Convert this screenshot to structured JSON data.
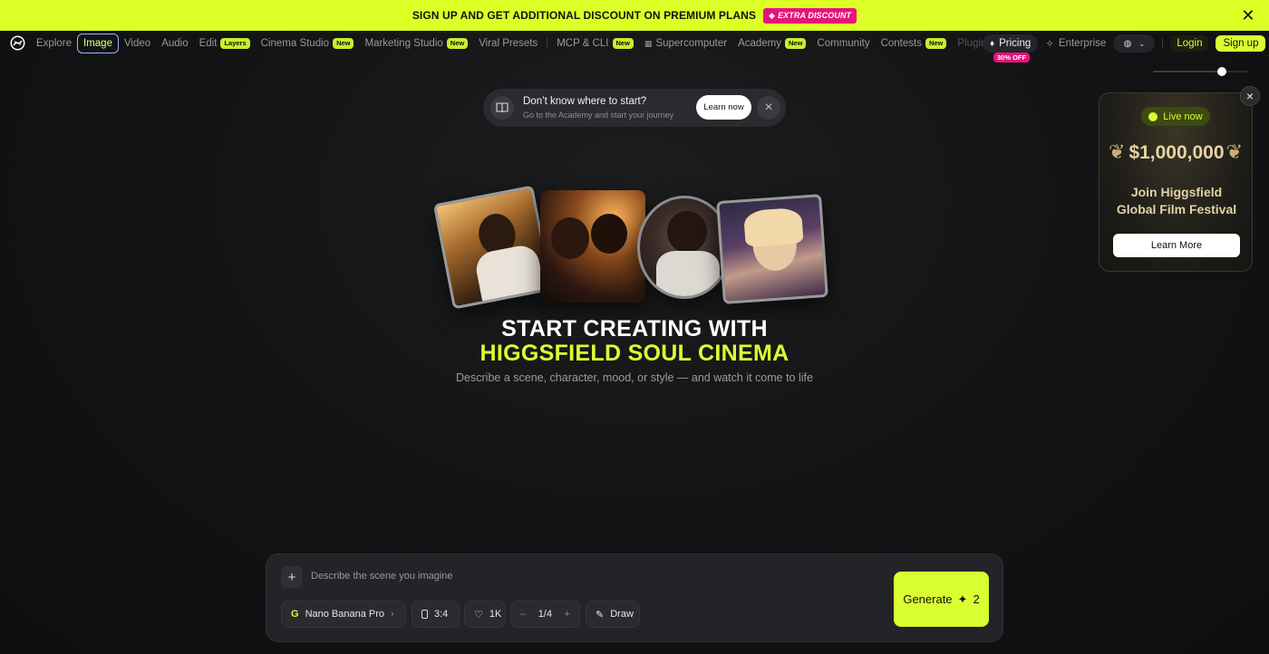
{
  "promo": {
    "text": "SIGN UP AND GET ADDITIONAL DISCOUNT ON PREMIUM PLANS",
    "badge": "EXTRA DISCOUNT",
    "close_icon": "close-icon"
  },
  "nav": {
    "logo_icon": "higgsfield-logo-icon",
    "items": [
      {
        "label": "Explore"
      },
      {
        "label": "Image",
        "active": true
      },
      {
        "label": "Video"
      },
      {
        "label": "Audio"
      },
      {
        "label": "Edit",
        "tag": "Layers"
      },
      {
        "label": "Cinema Studio",
        "tag": "New"
      },
      {
        "label": "Marketing Studio",
        "tag": "New"
      },
      {
        "label": "Viral Presets"
      },
      {
        "label": "MCP & CLI",
        "tag": "New"
      },
      {
        "label": "Supercomputer"
      },
      {
        "label": "Academy",
        "tag": "New"
      },
      {
        "label": "Community"
      },
      {
        "label": "Contests",
        "tag": "New"
      },
      {
        "label": "Plugins"
      }
    ],
    "pricing": {
      "label": "Pricing",
      "badge": "30% OFF"
    },
    "enterprise": "Enterprise",
    "login": "Login",
    "signup": "Sign up"
  },
  "zoom_slider": {
    "value": 0.72
  },
  "tip": {
    "title": "Don’t know where to start?",
    "subtitle": "Go to the Academy and start your journey",
    "button": "Learn now"
  },
  "hero": {
    "line1": "START CREATING WITH",
    "line2": "HIGGSFIELD SOUL CINEMA",
    "subtitle": "Describe a scene, character, mood, or style — and watch it come to life"
  },
  "festival": {
    "status": "Live now",
    "prize": "$1,000,000",
    "title_line1": "Join Higgsfield",
    "title_line2": "Global Film Festival",
    "button": "Learn More"
  },
  "prompt": {
    "placeholder": "Describe the scene you imagine",
    "model": "Nano Banana Pro",
    "ratio": "3:4",
    "resolution": "1K",
    "count": "1/4",
    "draw": "Draw",
    "generate": "Generate",
    "generate_cost": "2"
  },
  "colors": {
    "accent": "#d9ff33",
    "promo_badge": "#e6137c",
    "background": "#131415"
  }
}
